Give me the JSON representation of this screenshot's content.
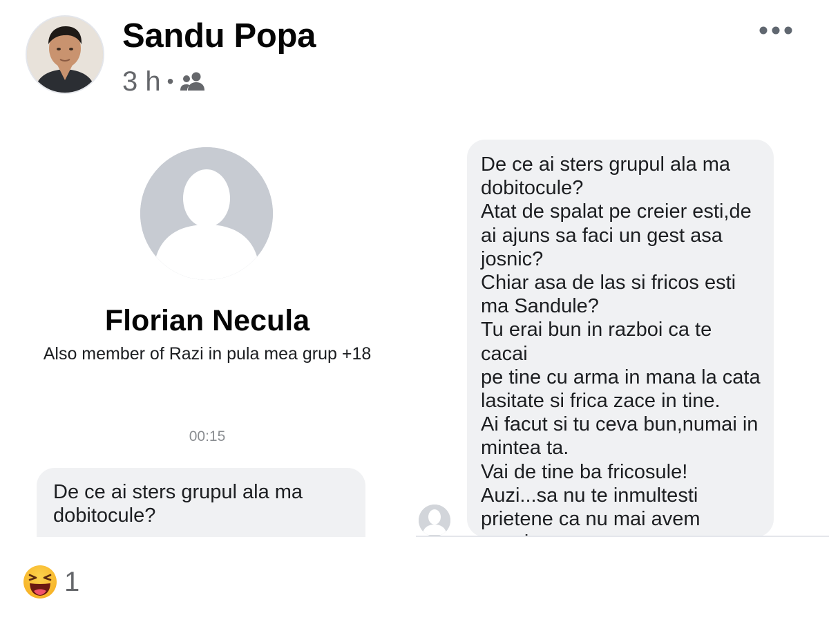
{
  "post": {
    "author": "Sandu Popa",
    "time": "3 h",
    "separator": "•",
    "audience_icon": "friends-icon",
    "more_icon": "more-horizontal-icon"
  },
  "screenshot": {
    "left_panel": {
      "contact_name": "Florian Necula",
      "contact_subtitle": "Also member of Razi in pula mea grup +18",
      "timestamp": "00:15",
      "message_preview": "De ce ai sters grupul ala ma\ndobitocule?"
    },
    "right_panel": {
      "message": "De ce ai sters grupul ala ma\ndobitocule?\nAtat de spalat pe creier esti,de\nai ajuns sa faci un gest asa\njosnic?\nChiar asa de las si fricos esti\nma Sandule?\nTu erai bun in razboi ca te cacai\npe tine cu arma in mana la cata\nlasitate si frica zace in tine.\nAi facut si tu ceva bun,numai in\nmintea ta.\nVai de tine ba fricosule!\nAuzi...sa nu te inmultesti\nprietene ca nu mai avem nevoie\nde altii ca tine.Esti de ajuns tu."
    }
  },
  "reactions": {
    "icon": "haha-reaction-icon",
    "count": "1",
    "colors": {
      "face": "#f7b125",
      "mouth": "#6b1a12"
    }
  },
  "colors": {
    "bubble": "#f0f1f3",
    "secondary_text": "#65676b",
    "placeholder_avatar": "#c7cbd2"
  }
}
